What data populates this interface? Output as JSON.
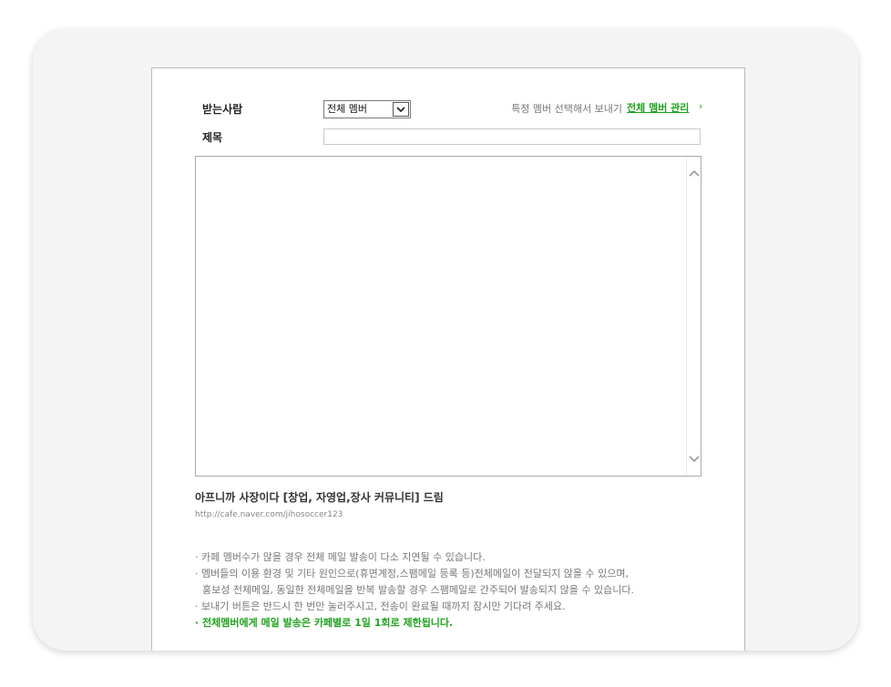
{
  "form": {
    "recipient_label": "받는사람",
    "recipient_select_value": "전체 멤버",
    "select_specific_text": "특정 멤버 선택해서 보내기",
    "manage_all_link": "전체 멤버 관리",
    "manage_bullet": "›",
    "subject_label": "제목",
    "subject_value": "",
    "body_value": ""
  },
  "cafe": {
    "name": "아프니까 사장이다 [창업, 자영업,장사 커뮤니티] 드림",
    "url": "http://cafe.naver.com/jihosoccer123"
  },
  "notices": [
    "· 카페 멤버수가 많을 경우 전체 메일 발송이 다소 지연될 수 있습니다.",
    "· 멤버들의 이용 환경 및 기타 원인으로(휴면계정,스팸메일 등록 등)전체메일이 전달되지 않을 수 있으며,",
    "홍보성 전체메일, 동일한 전체메일을 반복 발송할 경우 스팸메일로 간주되어 발송되지 않을 수 있습니다.",
    "· 보내기 버튼은 반드시 한 번만 눌러주시고, 전송이 완료될 때까지 잠시만 기다려 주세요.",
    "· 전체멤버에게 메일 발송은 카페별로 1일 1회로 제한됩니다."
  ],
  "colors": {
    "accent_green": "#1fa31f"
  },
  "icons": {
    "select_arrow": "chevron-down-icon",
    "scroll_up": "chevron-up-icon",
    "scroll_down": "chevron-down-icon"
  }
}
